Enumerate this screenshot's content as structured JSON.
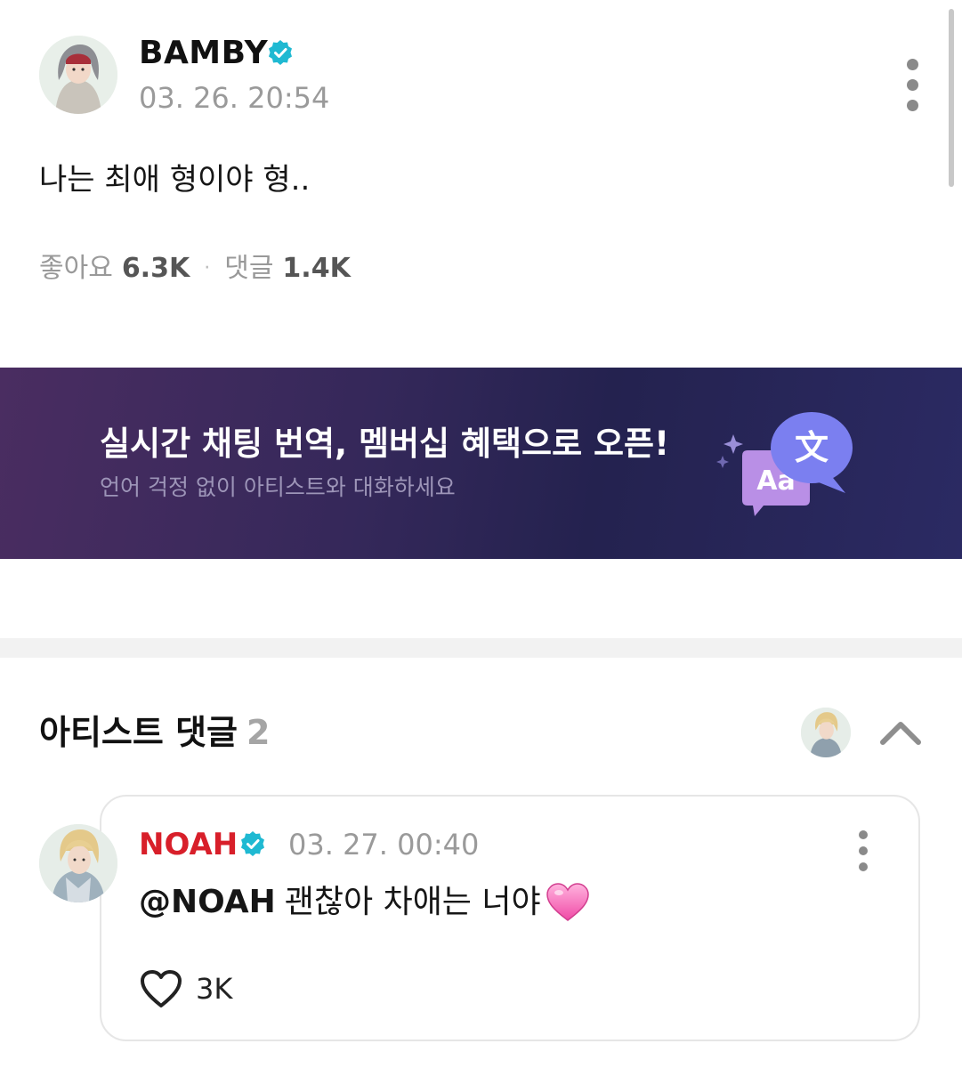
{
  "post": {
    "author": "BAMBY",
    "time": "03. 26. 20:54",
    "text": "나는 최애 형이야 형..",
    "likes_label": "좋아요",
    "likes_count": "6.3K",
    "comments_label": "댓글",
    "comments_count": "1.4K",
    "separator": "·"
  },
  "banner": {
    "title": "실시간 채팅 번역, 멤버십 혜택으로 오픈!",
    "subtitle": "언어 걱정 없이 아티스트와 대화하세요",
    "art_text_back": "Aa",
    "art_text_front": "文"
  },
  "artist_comments": {
    "title": "아티스트 댓글",
    "count": "2",
    "comment": {
      "author": "NOAH",
      "time": "03. 27. 00:40",
      "mention": "@NOAH",
      "text": "괜찮아 차애는 너야",
      "likes": "3K"
    }
  },
  "colors": {
    "verified": "#1fb9d2",
    "artist_name": "#d81f2a",
    "banner_bg": "#2e275a"
  },
  "icons": [
    "verified-badge-icon",
    "more-vertical-icon",
    "chevron-up-icon",
    "heart-icon",
    "pink-heart-emoji",
    "sparkle-icon"
  ]
}
